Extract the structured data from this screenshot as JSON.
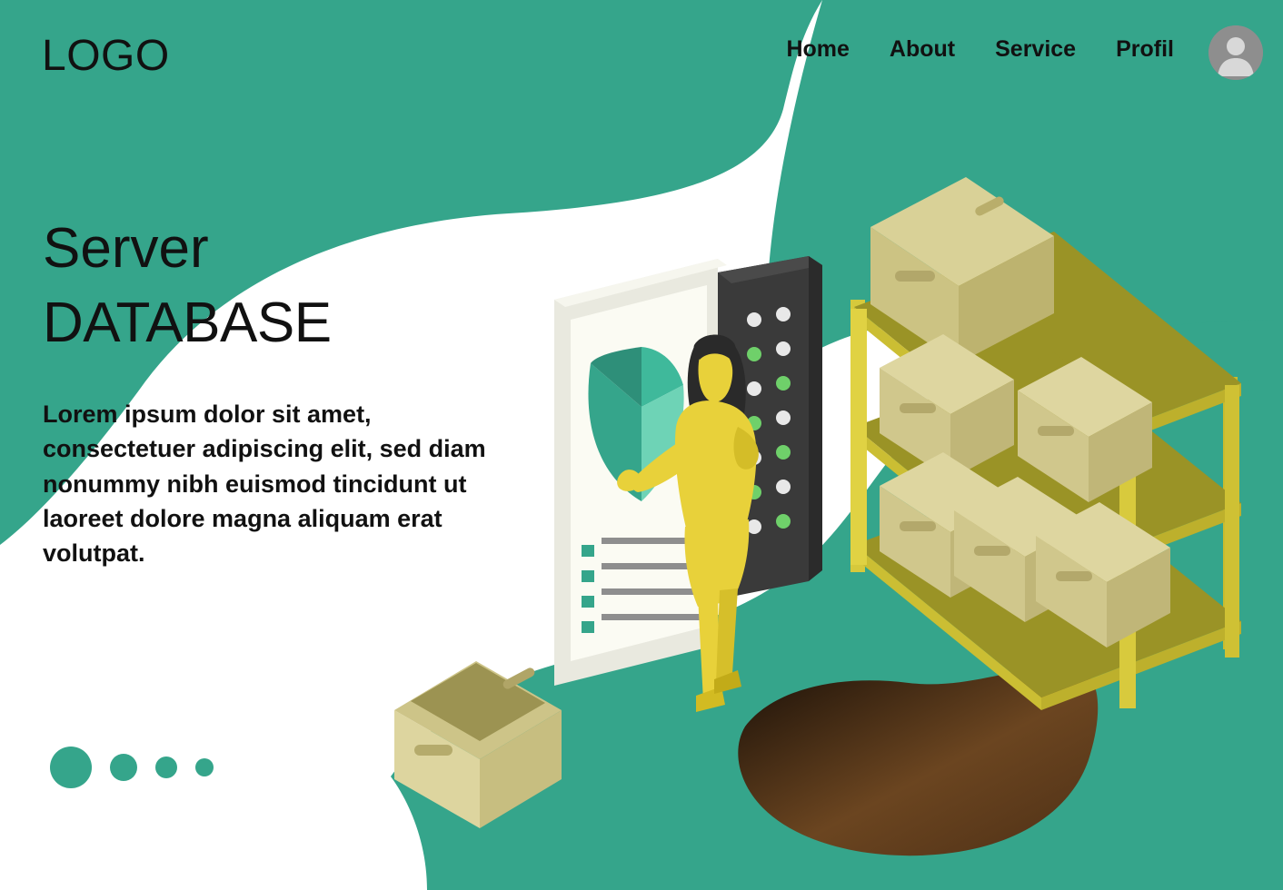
{
  "header": {
    "logo": "LOGO",
    "nav": [
      {
        "label": "Home"
      },
      {
        "label": "About"
      },
      {
        "label": "Service"
      },
      {
        "label": "Profil"
      }
    ],
    "avatar_icon": "user-avatar-icon"
  },
  "hero": {
    "title_line1": "Server",
    "title_line2": "DATABASE",
    "paragraph": "Lorem ipsum dolor sit amet, consectetuer adipiscing elit, sed diam nonummy nibh euismod tincidunt ut laoreet dolore magna aliquam erat volutpat."
  },
  "pagination": {
    "dots": [
      "active",
      "inactive",
      "inactive",
      "inactive"
    ]
  },
  "colors": {
    "teal": "#35a58b",
    "teal_dark": "#2f9a81",
    "white": "#ffffff",
    "text": "#111111",
    "yellow": "#e8d13a",
    "yellow_dark": "#d2bb22",
    "box_tan": "#ded8a0",
    "box_tan_dark": "#c9c07c",
    "server_dark": "#3a3a3a",
    "brown": "#5c3a1e"
  },
  "illustration": {
    "name": "isometric-server-database-illustration",
    "elements": [
      {
        "name": "phone-screen-chart"
      },
      {
        "name": "server-rack-tower"
      },
      {
        "name": "woman-character"
      },
      {
        "name": "storage-shelf-with-boxes"
      },
      {
        "name": "floor-open-box"
      },
      {
        "name": "brown-blob-shadow"
      }
    ]
  }
}
